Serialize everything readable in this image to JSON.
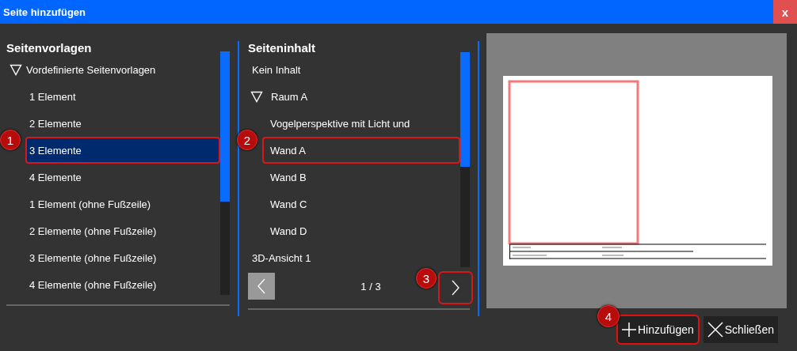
{
  "window": {
    "title": "Seite hinzufügen",
    "close_label": "x"
  },
  "templates": {
    "heading": "Seitenvorlagen",
    "items": [
      {
        "label": "Vordefinierte Seitenvorlagen",
        "expanded": true,
        "selected": false,
        "children": [
          {
            "label": "1 Element",
            "selected": false
          },
          {
            "label": "2 Elemente",
            "selected": false
          },
          {
            "label": "3 Elemente",
            "selected": true,
            "callout": "1"
          },
          {
            "label": "4 Elemente",
            "selected": false
          },
          {
            "label": "1 Element (ohne Fußzeile)",
            "selected": false
          },
          {
            "label": "2 Elemente (ohne Fußzeile)",
            "selected": false
          },
          {
            "label": "3 Elemente (ohne Fußzeile)",
            "selected": false
          },
          {
            "label": "4 Elemente (ohne Fußzeile)",
            "selected": false
          }
        ]
      }
    ]
  },
  "content": {
    "heading": "Seiteninhalt",
    "items": [
      {
        "label": "Kein Inhalt",
        "selected": false
      },
      {
        "label": "Raum A",
        "expanded": true,
        "selected": false,
        "children": [
          {
            "label": "Vogelperspektive mit Licht und",
            "selected": false
          },
          {
            "label": "Wand A",
            "selected": false,
            "callout": "2"
          },
          {
            "label": "Wand B",
            "selected": false
          },
          {
            "label": "Wand C",
            "selected": false
          },
          {
            "label": "Wand D",
            "selected": false
          }
        ]
      },
      {
        "label": "3D-Ansicht 1",
        "selected": false
      }
    ],
    "pager": {
      "page": "1 / 3",
      "prev_disabled": true,
      "next_disabled": false,
      "next_callout": "3"
    }
  },
  "buttons": [
    {
      "kind": "add",
      "label": "Hinzufügen",
      "callout": "4"
    },
    {
      "kind": "close",
      "label": "Schließen"
    }
  ]
}
